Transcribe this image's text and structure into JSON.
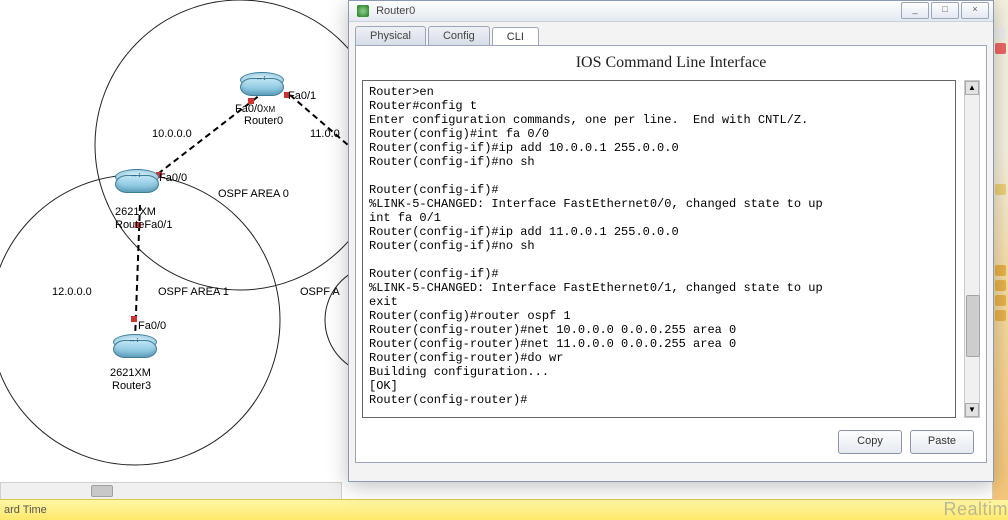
{
  "window": {
    "title": "Router0",
    "min_label": "_",
    "max_label": "□",
    "close_label": "×"
  },
  "tabs": {
    "physical": "Physical",
    "config": "Config",
    "cli": "CLI"
  },
  "cli": {
    "heading": "IOS Command Line Interface",
    "output": "Router>en\nRouter#config t\nEnter configuration commands, one per line.  End with CNTL/Z.\nRouter(config)#int fa 0/0\nRouter(config-if)#ip add 10.0.0.1 255.0.0.0\nRouter(config-if)#no sh\n\nRouter(config-if)#\n%LINK-5-CHANGED: Interface FastEthernet0/0, changed state to up\nint fa 0/1\nRouter(config-if)#ip add 11.0.0.1 255.0.0.0\nRouter(config-if)#no sh\n\nRouter(config-if)#\n%LINK-5-CHANGED: Interface FastEthernet0/1, changed state to up\nexit\nRouter(config)#router ospf 1\nRouter(config-router)#net 10.0.0.0 0.0.0.255 area 0\nRouter(config-router)#net 11.0.0.0 0.0.0.255 area 0\nRouter(config-router)#do wr\nBuilding configuration...\n[OK]\nRouter(config-router)#",
    "copy": "Copy",
    "paste": "Paste"
  },
  "topology": {
    "area0": "OSPF AREA 0",
    "area1": "OSPF AREA 1",
    "area_partial": "OSPF A",
    "router0_model": "2621XM",
    "router0_name": "Router0",
    "router1_model": "2621XM",
    "router1_name": "Router1",
    "router3_model": "2621XM",
    "router3_name": "Router3",
    "net10": "10.0.0.0",
    "net11": "11.0.0",
    "net12": "12.0.0.0",
    "if_fa00": "Fa0/0",
    "if_fa01": "Fa0/1",
    "r1_fa01_combined": "RouteFa0/1"
  },
  "status": {
    "text": "ard Time"
  },
  "edge": "Realtim"
}
